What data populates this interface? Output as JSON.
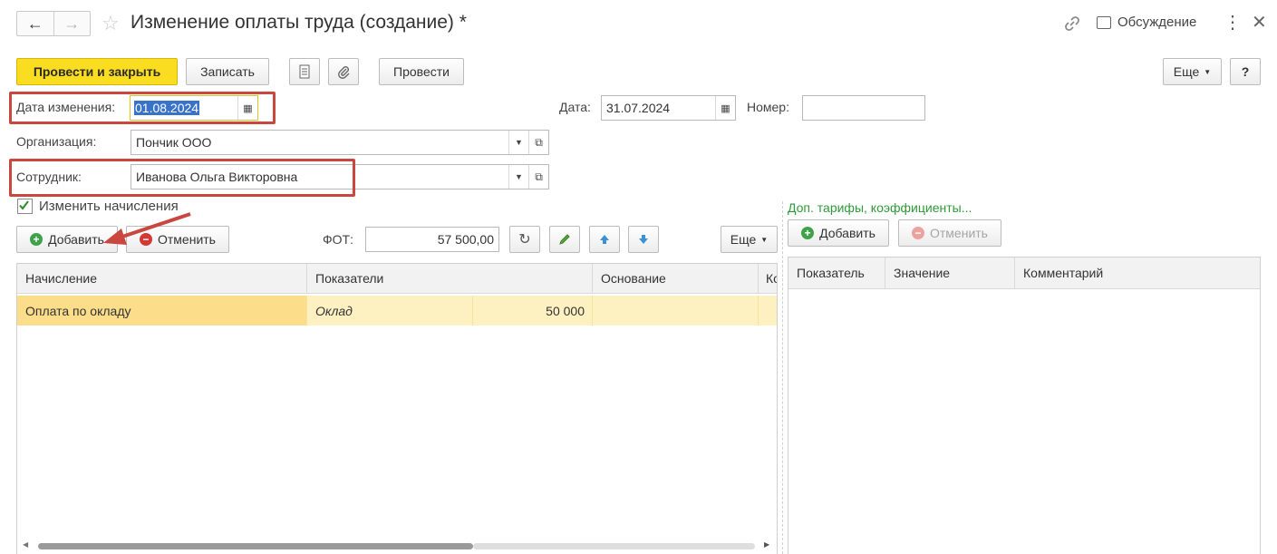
{
  "window": {
    "title": "Изменение оплаты труда (создание) *",
    "discussion": "Обсуждение"
  },
  "toolbar": {
    "post_close": "Провести и закрыть",
    "save": "Записать",
    "post": "Провести",
    "more": "Еще",
    "help": "?"
  },
  "form": {
    "change_date_label": "Дата изменения:",
    "change_date_value": "01.08.2024",
    "date_label": "Дата:",
    "date_value": "31.07.2024",
    "number_label": "Номер:",
    "number_value": "",
    "org_label": "Организация:",
    "org_value": "Пончик ООО",
    "employee_label": "Сотрудник:",
    "employee_value": "Иванова Ольга Викторовна",
    "change_accruals_label": "Изменить начисления",
    "change_accruals_checked": true
  },
  "accruals": {
    "add": "Добавить",
    "cancel": "Отменить",
    "fot_label": "ФОТ:",
    "fot_value": "57 500,00",
    "more": "Еще",
    "columns": [
      "Начисление",
      "Показатели",
      "Основание",
      "Ко"
    ],
    "rows": [
      {
        "accrual": "Оплата по окладу",
        "indicator": "Оклад",
        "amount": "50 000",
        "basis": ""
      }
    ]
  },
  "tariffs": {
    "title": "Доп. тарифы, коэффициенты...",
    "add": "Добавить",
    "cancel": "Отменить",
    "columns": [
      "Показатель",
      "Значение",
      "Комментарий"
    ]
  },
  "colors": {
    "primary_button": "#fadc20",
    "highlight_border": "#c9473f",
    "selected_row": "#fdf1c2",
    "link_green": "#2f9a3a",
    "add_icon": "#3fa24a",
    "cancel_icon": "#d13a34",
    "arrow_icon": "#3d8fd6"
  }
}
